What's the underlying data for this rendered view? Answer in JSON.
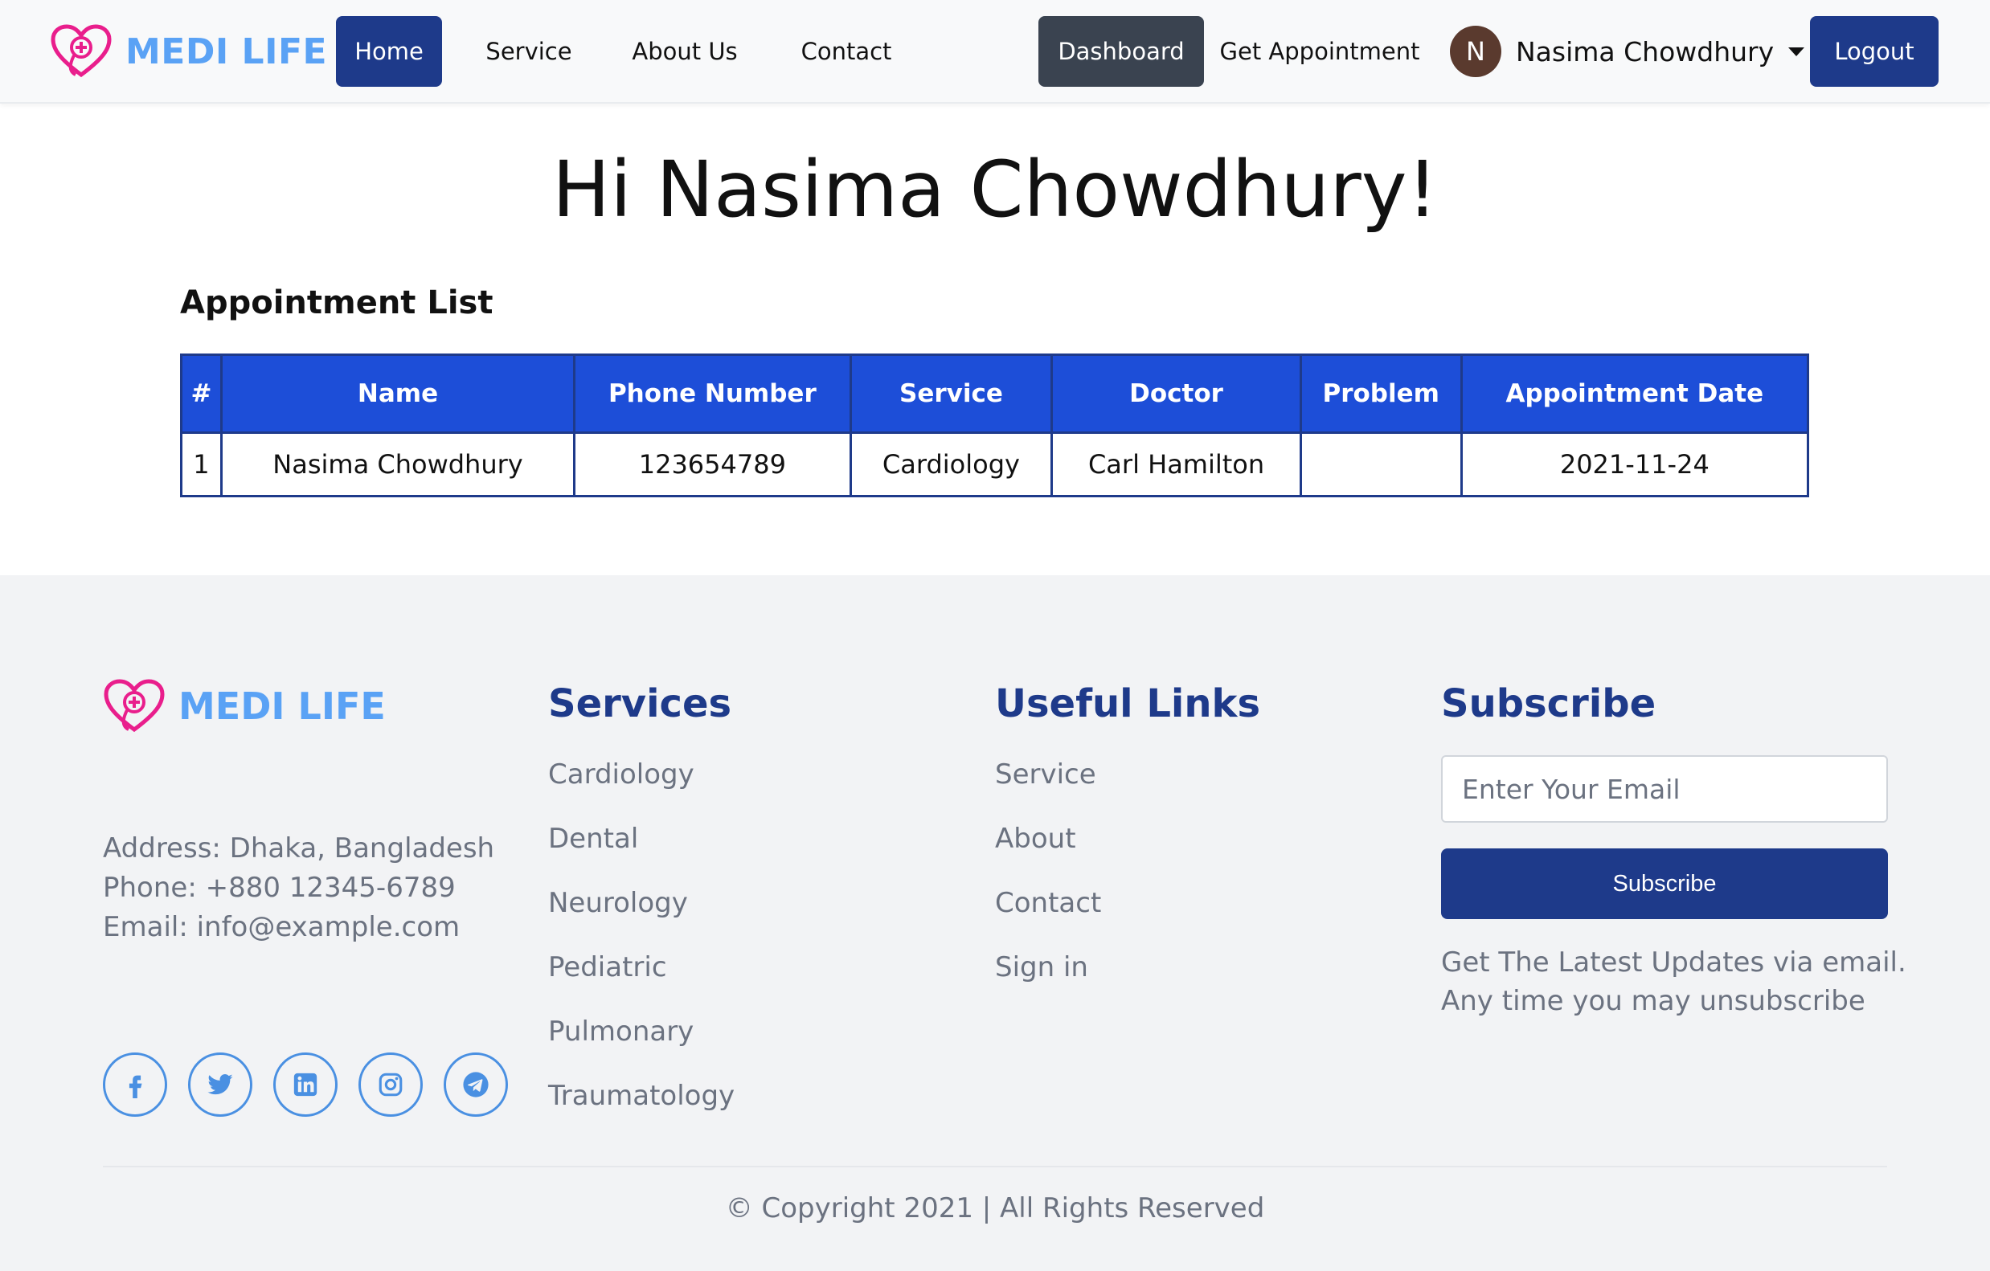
{
  "brand": {
    "name": "MEDI LIFE",
    "color": "#5aa2f5",
    "logo_color": "#e91e8c"
  },
  "nav": {
    "home": "Home",
    "service": "Service",
    "about": "About Us",
    "contact": "Contact",
    "dashboard": "Dashboard",
    "appointment": "Get Appointment",
    "user_initial": "N",
    "user_name": "Nasima Chowdhury",
    "logout": "Logout"
  },
  "main": {
    "greeting": "Hi Nasima Chowdhury!",
    "section_title": "Appointment List",
    "table": {
      "headers": [
        "#",
        "Name",
        "Phone Number",
        "Service",
        "Doctor",
        "Problem",
        "Appointment Date"
      ],
      "rows": [
        [
          "1",
          "Nasima Chowdhury",
          "123654789",
          "Cardiology",
          "Carl Hamilton",
          "",
          "2021-11-24"
        ]
      ]
    }
  },
  "footer": {
    "brand_name": "MEDI LIFE",
    "address": "Address: Dhaka, Bangladesh",
    "phone": "Phone: +880 12345-6789",
    "email": "Email: info@example.com",
    "socials": [
      "facebook-icon",
      "twitter-icon",
      "linkedin-icon",
      "instagram-icon",
      "telegram-icon"
    ],
    "services_title": "Services",
    "services": [
      "Cardiology",
      "Dental",
      "Neurology",
      "Pediatric",
      "Pulmonary",
      "Traumatology"
    ],
    "links_title": "Useful Links",
    "links": [
      "Service",
      "About",
      "Contact",
      "Sign in"
    ],
    "subscribe_title": "Subscribe",
    "email_placeholder": "Enter Your Email",
    "subscribe_button": "Subscribe",
    "subscribe_note_1": "Get The Latest Updates via email.",
    "subscribe_note_2": "Any time you may unsubscribe",
    "copyright": "© Copyright 2021 | All Rights Reserved"
  },
  "colors": {
    "primary": "#1e3a8a",
    "table_header": "#1d4ed8",
    "dashboard": "#3a4350",
    "muted_text": "#6b7280",
    "footer_bg": "#f2f3f5"
  }
}
